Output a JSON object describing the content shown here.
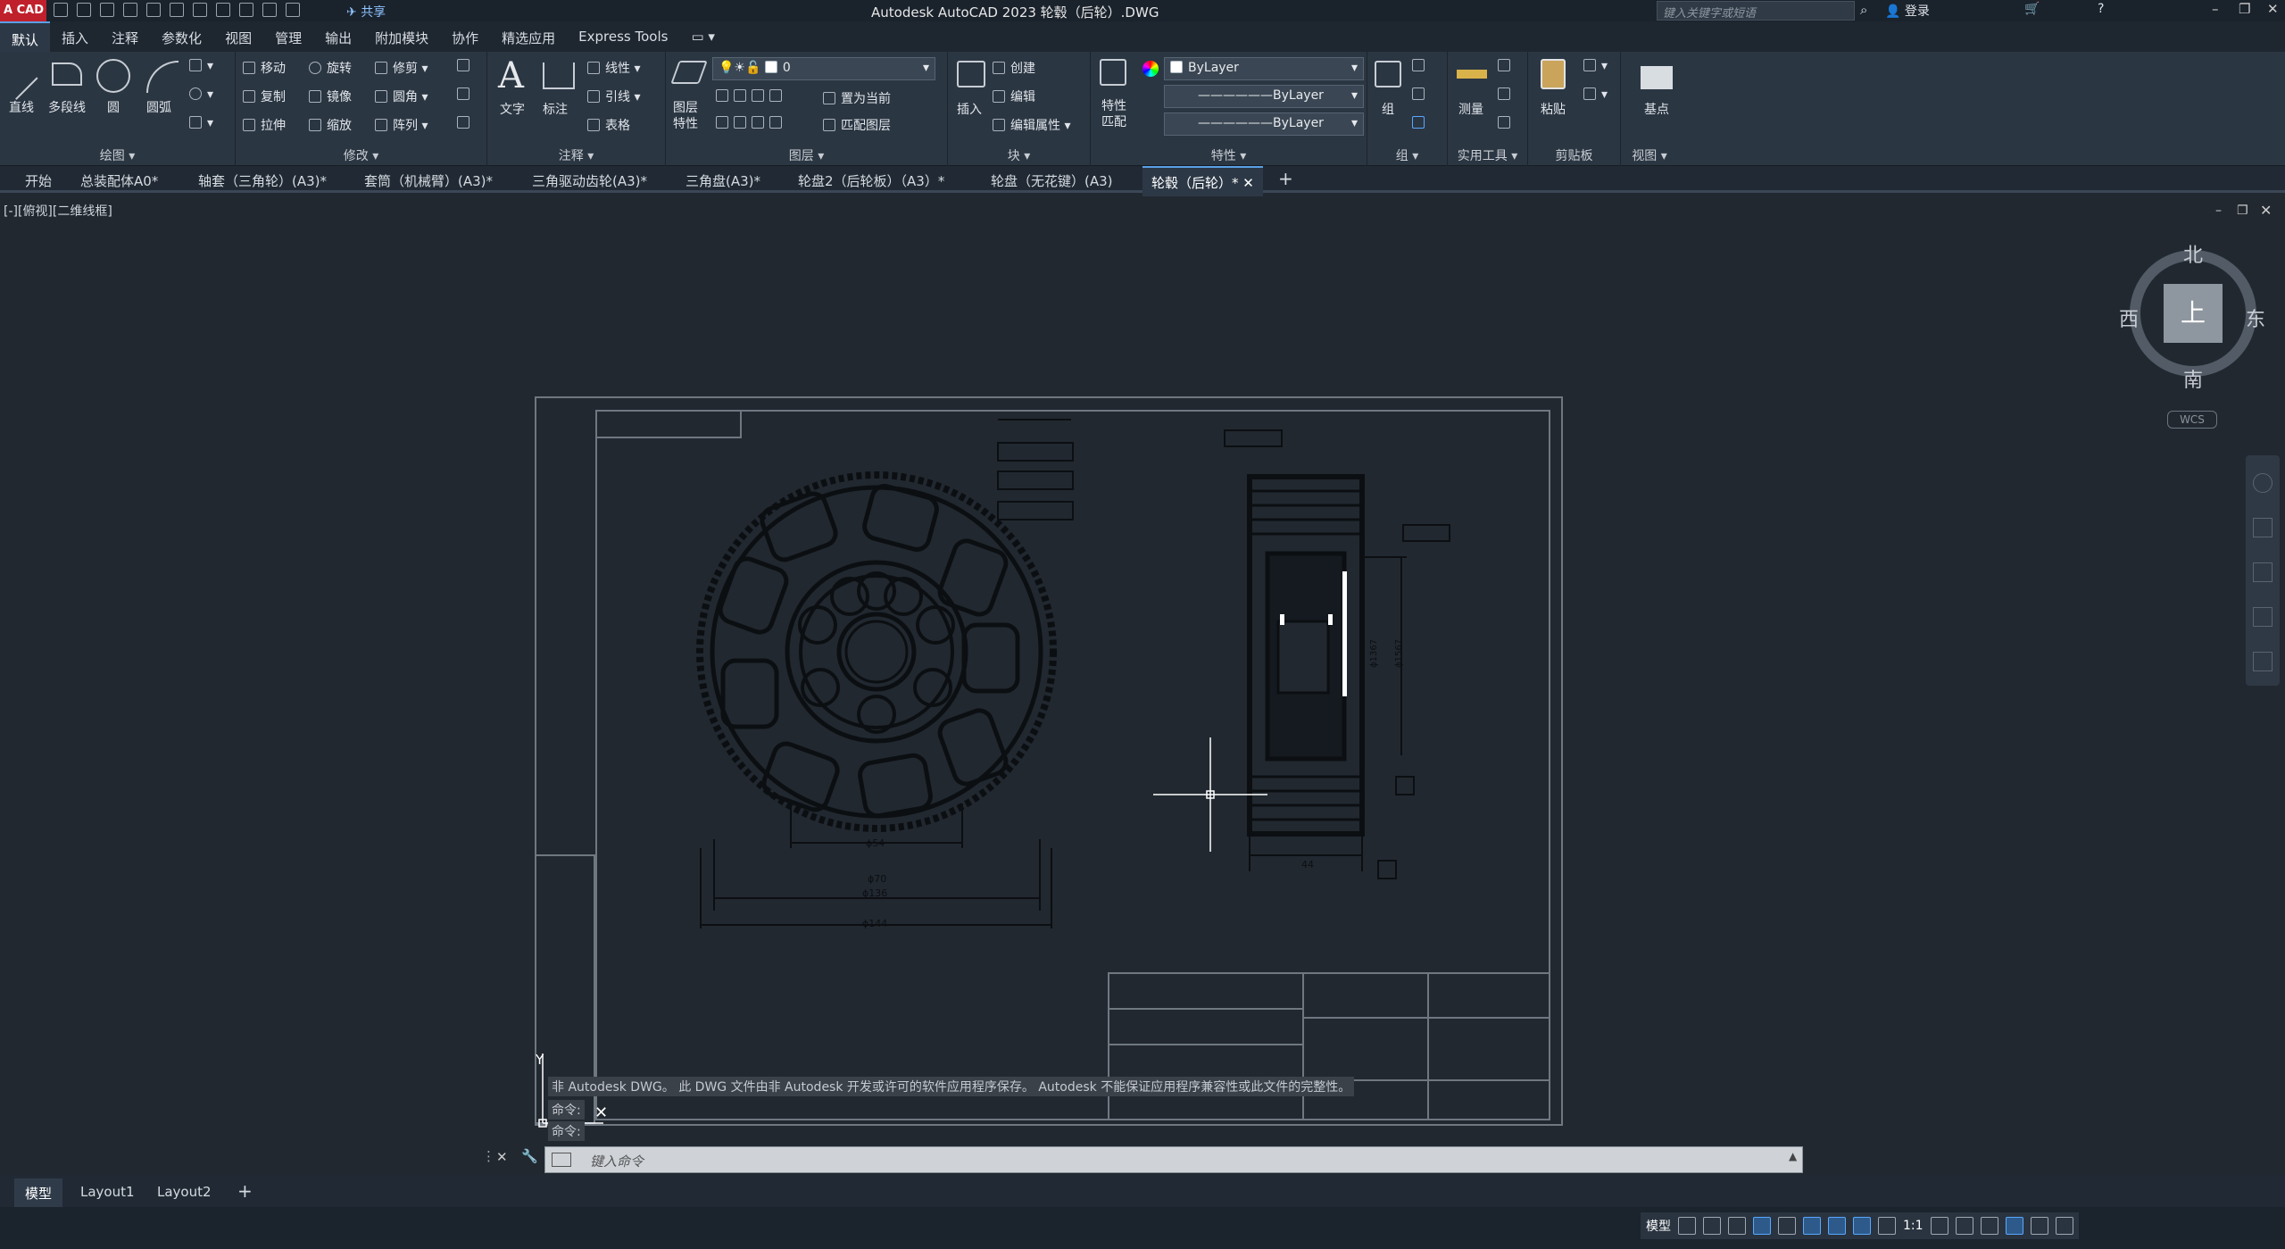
{
  "app": {
    "logo_text": "A CAD",
    "title": "Autodesk AutoCAD 2023    轮毂（后轮）.DWG",
    "share_label": "共享",
    "search_placeholder": "键入关键字或短语",
    "login_label": "登录"
  },
  "menu": [
    "默认",
    "插入",
    "注释",
    "参数化",
    "视图",
    "管理",
    "输出",
    "附加模块",
    "协作",
    "精选应用",
    "Express Tools"
  ],
  "ribbon": {
    "draw": {
      "label": "绘图",
      "line": "直线",
      "polyline": "多段线",
      "circle": "圆",
      "arc": "圆弧"
    },
    "modify": {
      "label": "修改",
      "move": "移动",
      "rotate": "旋转",
      "trim": "修剪",
      "copy": "复制",
      "mirror": "镜像",
      "fillet": "圆角",
      "stretch": "拉伸",
      "scale": "缩放",
      "array": "阵列"
    },
    "annotation": {
      "label": "注释",
      "text": "文字",
      "dimension": "标注",
      "linear": "线性",
      "leader": "引线",
      "table": "表格"
    },
    "layers": {
      "label": "图层",
      "layer_props": "图层\n特性",
      "current_layer": "0",
      "make_current": "置为当前",
      "match_layer": "匹配图层"
    },
    "block": {
      "label": "块",
      "insert": "插入",
      "create": "创建",
      "edit": "编辑",
      "edit_attr": "编辑属性"
    },
    "properties": {
      "label": "特性",
      "match": "特性\n匹配",
      "color": "ByLayer",
      "linetype": "ByLayer",
      "lineweight": "ByLayer"
    },
    "groups": {
      "label": "组",
      "group": "组"
    },
    "utilities": {
      "label": "实用工具",
      "measure": "测量"
    },
    "clipboard": {
      "label": "剪贴板",
      "paste": "粘贴"
    },
    "view": {
      "label": "视图",
      "base": "基点"
    }
  },
  "tabs": [
    "开始",
    "总装配体A0*",
    "轴套（三角轮）(A3)*",
    "套筒（机械臂）(A3)*",
    "三角驱动齿轮(A3)*",
    "三角盘(A3)*",
    "轮盘2（后轮板）（A3）*",
    "轮盘（无花键）(A3)",
    "轮毂（后轮）*"
  ],
  "viewport": {
    "label": "[-][俯视][二维线框]",
    "compass": {
      "top": "上",
      "north": "北",
      "south": "南",
      "east": "东",
      "west": "西",
      "wcs": "WCS"
    },
    "dims": {
      "d54": "ϕ54",
      "d70": "ϕ70",
      "d136": "ϕ136",
      "d144": "ϕ144",
      "w44": "44",
      "d1367": "ϕ1367",
      "d1567": "ϕ1567"
    }
  },
  "command": {
    "history": [
      "非 Autodesk DWG。 此 DWG 文件由非 Autodesk 开发或许可的软件应用程序保存。 Autodesk 不能保证应用程序兼容性或此文件的完整性。",
      "命令:",
      "命令:"
    ],
    "placeholder": "键入命令"
  },
  "layouts": [
    "模型",
    "Layout1",
    "Layout2"
  ],
  "status": {
    "model": "模型",
    "scale": "1:1"
  }
}
